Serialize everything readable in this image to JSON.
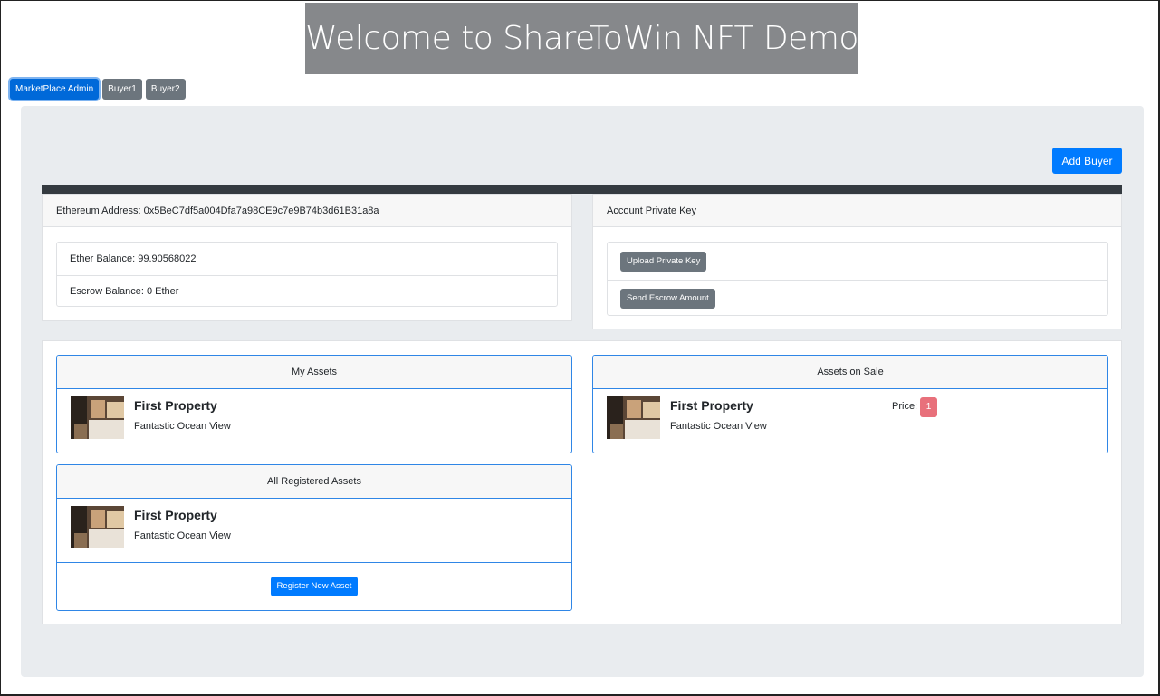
{
  "banner": {
    "title": "Welcome to ShareToWin NFT Demo"
  },
  "tabs": [
    {
      "label": "MarketPlace Admin",
      "active": true
    },
    {
      "label": "Buyer1",
      "active": false
    },
    {
      "label": "Buyer2",
      "active": false
    }
  ],
  "toolbar": {
    "add_buyer_label": "Add Buyer"
  },
  "account": {
    "address_label": "Ethereum Address: 0x5BeC7df5a004Dfa7a98CE9c7e9B74b3d61B31a8a",
    "ether_balance": "Ether Balance: 99.90568022",
    "escrow_balance": "Escrow Balance: 0 Ether"
  },
  "private_key": {
    "header": "Account Private Key",
    "upload_label": "Upload Private Key",
    "send_escrow_label": "Send Escrow Amount"
  },
  "my_assets": {
    "header": "My Assets",
    "items": [
      {
        "title": "First Property",
        "subtitle": "Fantastic Ocean View"
      }
    ]
  },
  "assets_on_sale": {
    "header": "Assets on Sale",
    "items": [
      {
        "title": "First Property",
        "subtitle": "Fantastic Ocean View",
        "price_label": "Price:",
        "price": "1"
      }
    ]
  },
  "registered_assets": {
    "header": "All Registered Assets",
    "items": [
      {
        "title": "First Property",
        "subtitle": "Fantastic Ocean View"
      }
    ],
    "register_label": "Register New Asset"
  },
  "colors": {
    "primary": "#007bff",
    "secondary": "#6c757d",
    "banner_bg": "#86888b",
    "price_badge": "#e8707b",
    "jumbotron_bg": "#e9ecef"
  }
}
